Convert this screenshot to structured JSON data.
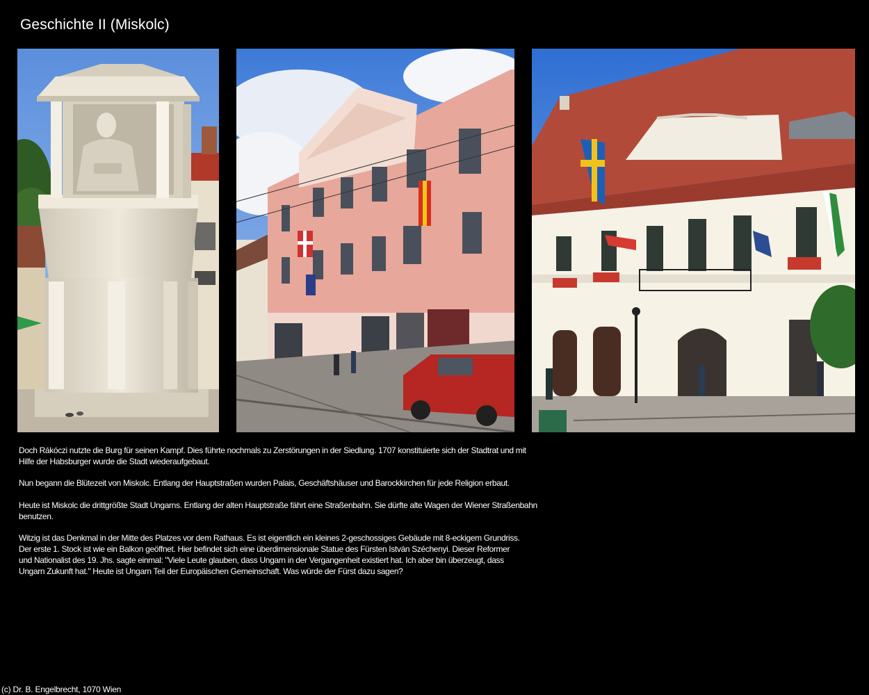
{
  "page": {
    "title": "Geschichte II (Miskolc)",
    "footer": "(c) Dr. B. Engelbrecht, 1070 Wien"
  },
  "photos": [
    {
      "label": "Monument statue of Count István Széchenyi in an octagonal pavilion"
    },
    {
      "label": "Pink baroque palais with flags and red pickup truck"
    },
    {
      "label": "White town hall with red tile roof and flags"
    }
  ],
  "text": {
    "p1": [
      "Doch Rákóczi nutzte die Burg für seinen Kampf. Dies führte nochmals zu Zerstörungen in der Siedlung. 1707 konstituierte sich der Stadtrat und mit",
      "Hilfe der Habsburger wurde die Stadt wiederaufgebaut."
    ],
    "p2": [
      "Nun begann die Blütezeit von Miskolc. Entlang der Hauptstraßen wurden Palais, Geschäftshäuser und Barockkirchen für jede Religion erbaut."
    ],
    "p3": [
      "Heute ist Miskolc die drittgrößte Stadt Ungarns. Entlang der alten Hauptstraße fährt eine Straßenbahn. Sie dürfte alte Wagen der Wiener Straßenbahn",
      "benutzen."
    ],
    "p4": [
      "Witzig ist das Denkmal in der Mitte des Platzes vor dem Rathaus. Es ist eigentlich ein kleines 2-geschossiges Gebäude mit 8-eckigem Grundriss.",
      "Der erste 1. Stock ist wie ein Balkon geöffnet. Hier befindet sich eine überdimensionale Statue des Fürsten István Széchenyi. Dieser Reformer",
      "und Nationalist des 19. Jhs. sagte einmal: \"Viele Leute glauben, dass Ungarn in der Vergangenheit existiert hat. Ich aber bin überzeugt, dass",
      "Ungarn Zukunft hat.\" Heute ist Ungarn Teil der Europäischen Gemeinschaft. Was würde der Fürst dazu sagen?"
    ]
  }
}
